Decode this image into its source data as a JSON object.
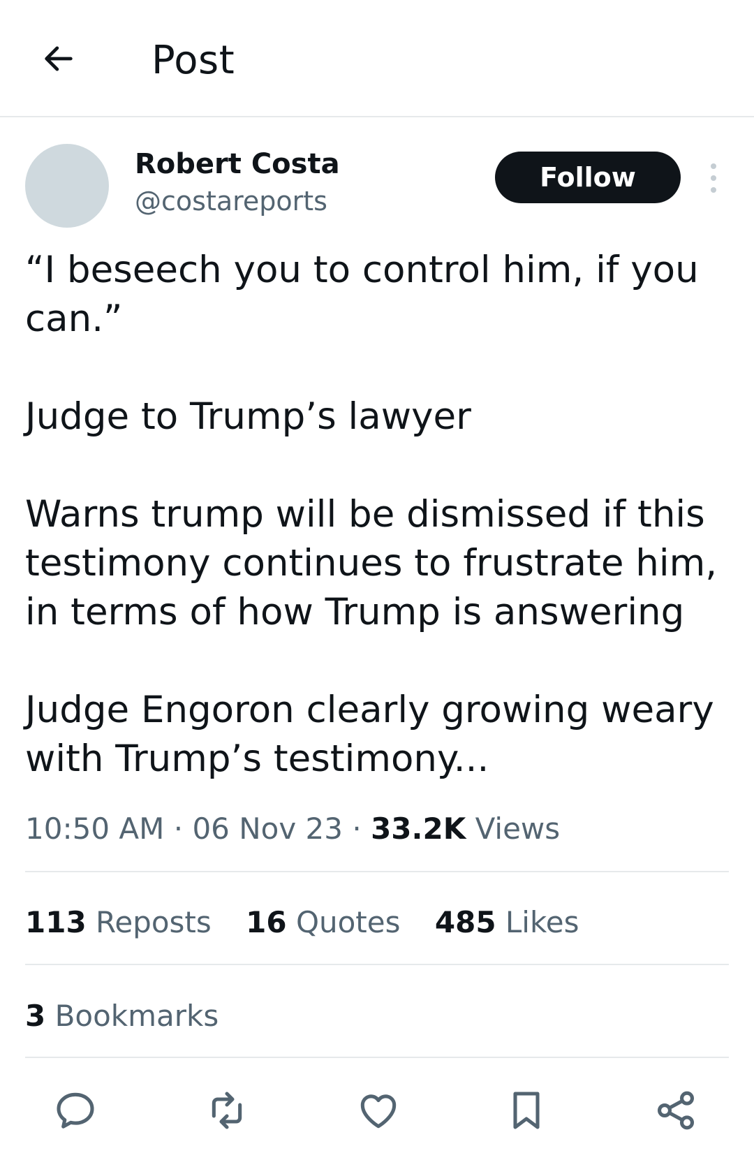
{
  "header": {
    "title": "Post"
  },
  "author": {
    "name": "Robert Costa",
    "handle": "@costareports",
    "follow_label": "Follow"
  },
  "post": {
    "paragraphs": [
      "“I beseech you to control him, if you can.”",
      "Judge to Trump’s lawyer",
      "Warns trump will be dismissed if this testimony continues to frustrate him, in terms of how Trump is answering",
      "Judge Engoron clearly growing weary with Trump’s testimony..."
    ]
  },
  "meta": {
    "time": "10:50 AM",
    "date": "06 Nov 23",
    "views_count": "33.2K",
    "views_label": "Views",
    "separator": "·"
  },
  "stats": {
    "reposts_count": "113",
    "reposts_label": "Reposts",
    "quotes_count": "16",
    "quotes_label": "Quotes",
    "likes_count": "485",
    "likes_label": "Likes"
  },
  "bookmarks": {
    "count": "3",
    "label": "Bookmarks"
  },
  "actions": [
    "reply-icon",
    "repost-icon",
    "like-icon",
    "bookmark-icon",
    "share-icon"
  ],
  "colors": {
    "text": "#0f1419",
    "secondary": "#536471",
    "divider": "#e6e9eb",
    "avatar": "#cfd9de",
    "follow_bg": "#0f1419"
  }
}
